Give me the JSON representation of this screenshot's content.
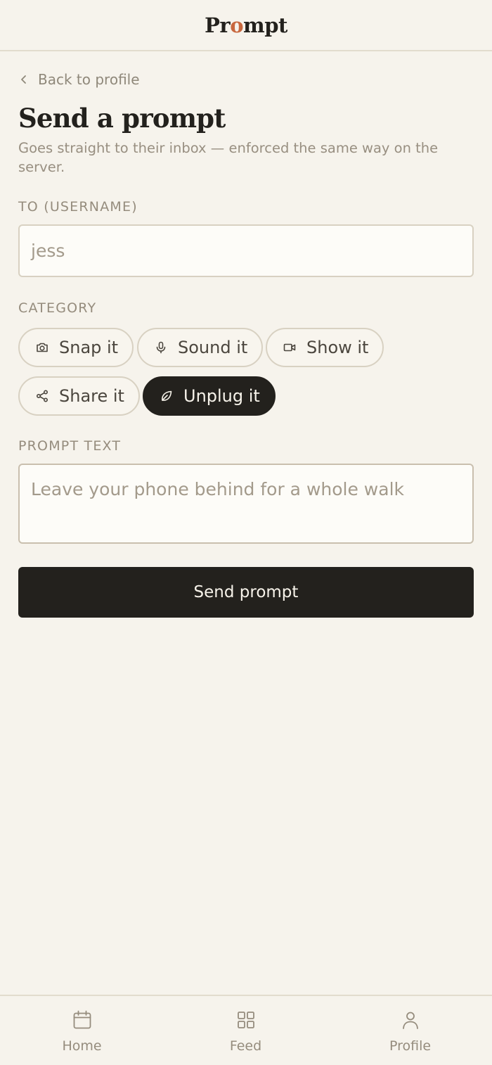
{
  "header": {
    "logo_part1": "Pr",
    "logo_accent": "o",
    "logo_part2": "mpt"
  },
  "colors": {
    "background": "#f6f3ec",
    "accent": "#c8683f",
    "dark": "#23211d",
    "muted": "#958c7d"
  },
  "back_link": {
    "label": "Back to profile",
    "icon": "chevron-left-icon"
  },
  "page": {
    "title": "Send a prompt",
    "subtitle": "Goes straight to their inbox — enforced the same way on the server."
  },
  "recipient": {
    "label": "TO (USERNAME)",
    "placeholder": "jess",
    "value": ""
  },
  "category": {
    "label": "CATEGORY",
    "selected": "Unplug it",
    "options": [
      {
        "label": "Snap it",
        "icon": "camera-icon"
      },
      {
        "label": "Sound it",
        "icon": "microphone-icon"
      },
      {
        "label": "Show it",
        "icon": "video-icon"
      },
      {
        "label": "Share it",
        "icon": "share-icon"
      },
      {
        "label": "Unplug it",
        "icon": "leaf-icon"
      }
    ]
  },
  "prompt_text": {
    "label": "PROMPT TEXT",
    "placeholder": "Leave your phone behind for a whole walk",
    "value": ""
  },
  "submit": {
    "label": "Send prompt"
  },
  "nav": {
    "items": [
      {
        "label": "Home",
        "icon": "calendar-icon"
      },
      {
        "label": "Feed",
        "icon": "grid-icon"
      },
      {
        "label": "Profile",
        "icon": "user-icon"
      }
    ]
  }
}
